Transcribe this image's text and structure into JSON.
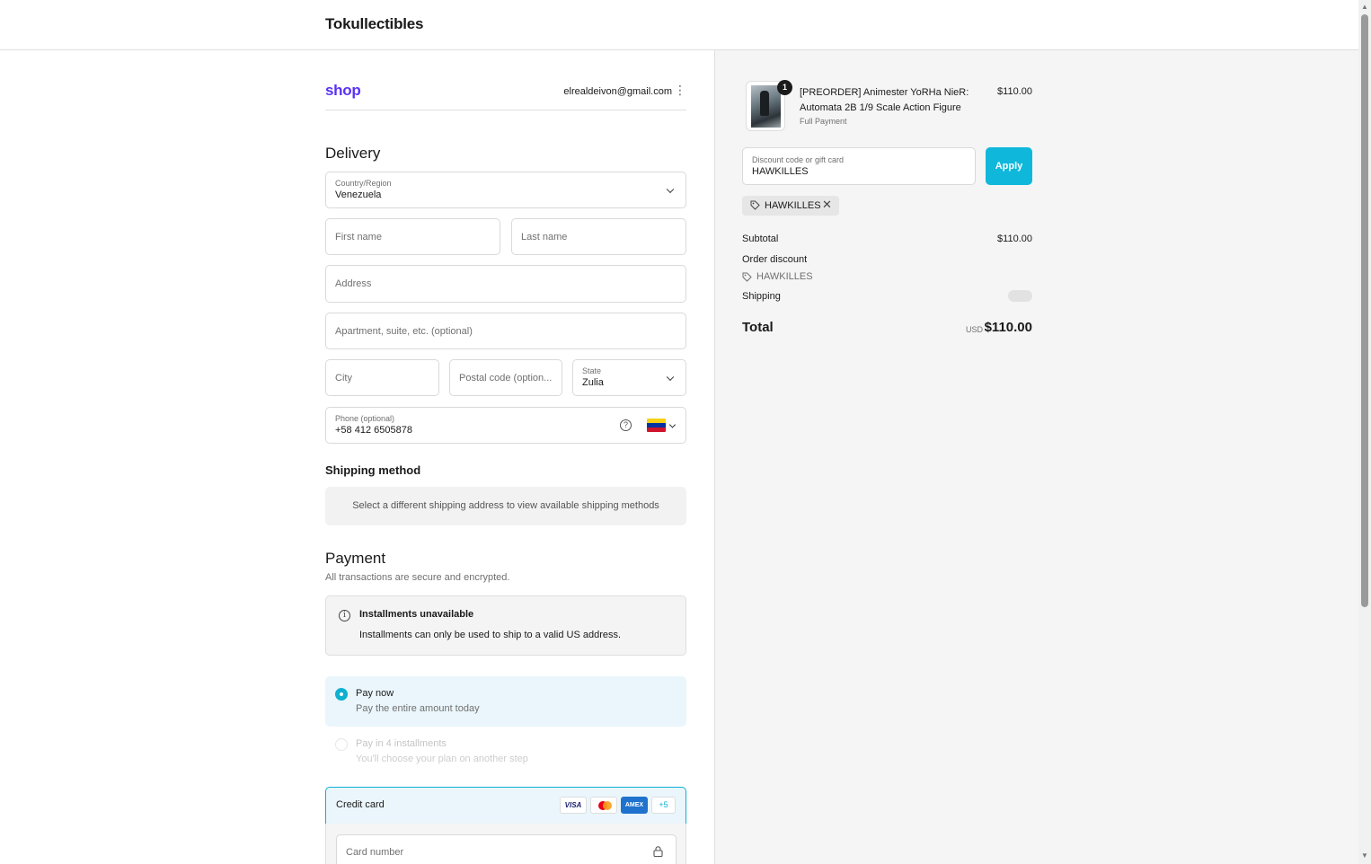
{
  "header": {
    "store_name": "Tokullectibles"
  },
  "account": {
    "shop_logo": "shop",
    "email": "elrealdeivon@gmail.com",
    "menu_icon": "kebab-icon"
  },
  "delivery": {
    "title": "Delivery",
    "country": {
      "label": "Country/Region",
      "value": "Venezuela"
    },
    "first_name": {
      "placeholder": "First name"
    },
    "last_name": {
      "placeholder": "Last name"
    },
    "address": {
      "placeholder": "Address"
    },
    "apartment": {
      "placeholder": "Apartment, suite, etc. (optional)"
    },
    "city": {
      "placeholder": "City"
    },
    "postal": {
      "placeholder": "Postal code (option..."
    },
    "state": {
      "label": "State",
      "value": "Zulia"
    },
    "phone": {
      "label": "Phone (optional)",
      "value": "+58 412 6505878",
      "help": "?"
    }
  },
  "shipping_method": {
    "title": "Shipping method",
    "message": "Select a different shipping address to view available shipping methods"
  },
  "payment": {
    "title": "Payment",
    "note": "All transactions are secure and encrypted.",
    "installments_notice": {
      "icon_glyph": "i",
      "title": "Installments unavailable",
      "body": "Installments can only be used to ship to a valid US address."
    },
    "options": [
      {
        "title": "Pay now",
        "subtitle": "Pay the entire amount today",
        "selected": true
      },
      {
        "title": "Pay in 4 installments",
        "subtitle": "You'll choose your plan on another step",
        "selected": false
      }
    ],
    "credit_card": {
      "title": "Credit card",
      "logos": [
        "VISA",
        "",
        "AMEX",
        "+5"
      ],
      "card_number_placeholder": "Card number"
    }
  },
  "summary": {
    "item": {
      "quantity": "1",
      "name": "[PREORDER] Animester YoRHa NieR: Automata 2B 1/9 Scale Action Figure",
      "variant": "Full Payment",
      "price": "$110.00"
    },
    "discount_field": {
      "label": "Discount code or gift card",
      "value": "HAWKILLES"
    },
    "apply_label": "Apply",
    "applied_code": "HAWKILLES",
    "remove_glyph": "✕",
    "subtotal_label": "Subtotal",
    "subtotal_value": "$110.00",
    "order_discount_label": "Order discount",
    "order_discount_code": "HAWKILLES",
    "shipping_label": "Shipping",
    "total_label": "Total",
    "currency": "USD",
    "total_value": "$110.00"
  },
  "colors": {
    "accent": "#0fb8db",
    "shop_brand": "#5a31f4"
  }
}
